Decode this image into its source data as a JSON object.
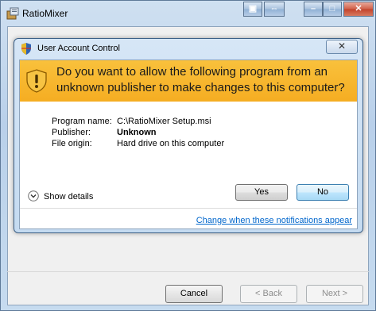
{
  "outer_window": {
    "title": "RatioMixer",
    "buttons": {
      "cancel": "Cancel",
      "back": "< Back",
      "next": "Next >"
    }
  },
  "uac": {
    "title": "User Account Control",
    "question": "Do you want to allow the following program from an unknown publisher to make changes to this computer?",
    "details": [
      {
        "label": "Program name:",
        "value": "C:\\RatioMixer Setup.msi",
        "bold": false
      },
      {
        "label": "Publisher:",
        "value": "Unknown",
        "bold": true
      },
      {
        "label": "File origin:",
        "value": "Hard drive on this computer",
        "bold": false
      }
    ],
    "show_details": "Show details",
    "yes": "Yes",
    "no": "No",
    "change_link": "Change when these notifications appear"
  },
  "colors": {
    "banner": "#f5ad22",
    "link": "#0066cc"
  }
}
